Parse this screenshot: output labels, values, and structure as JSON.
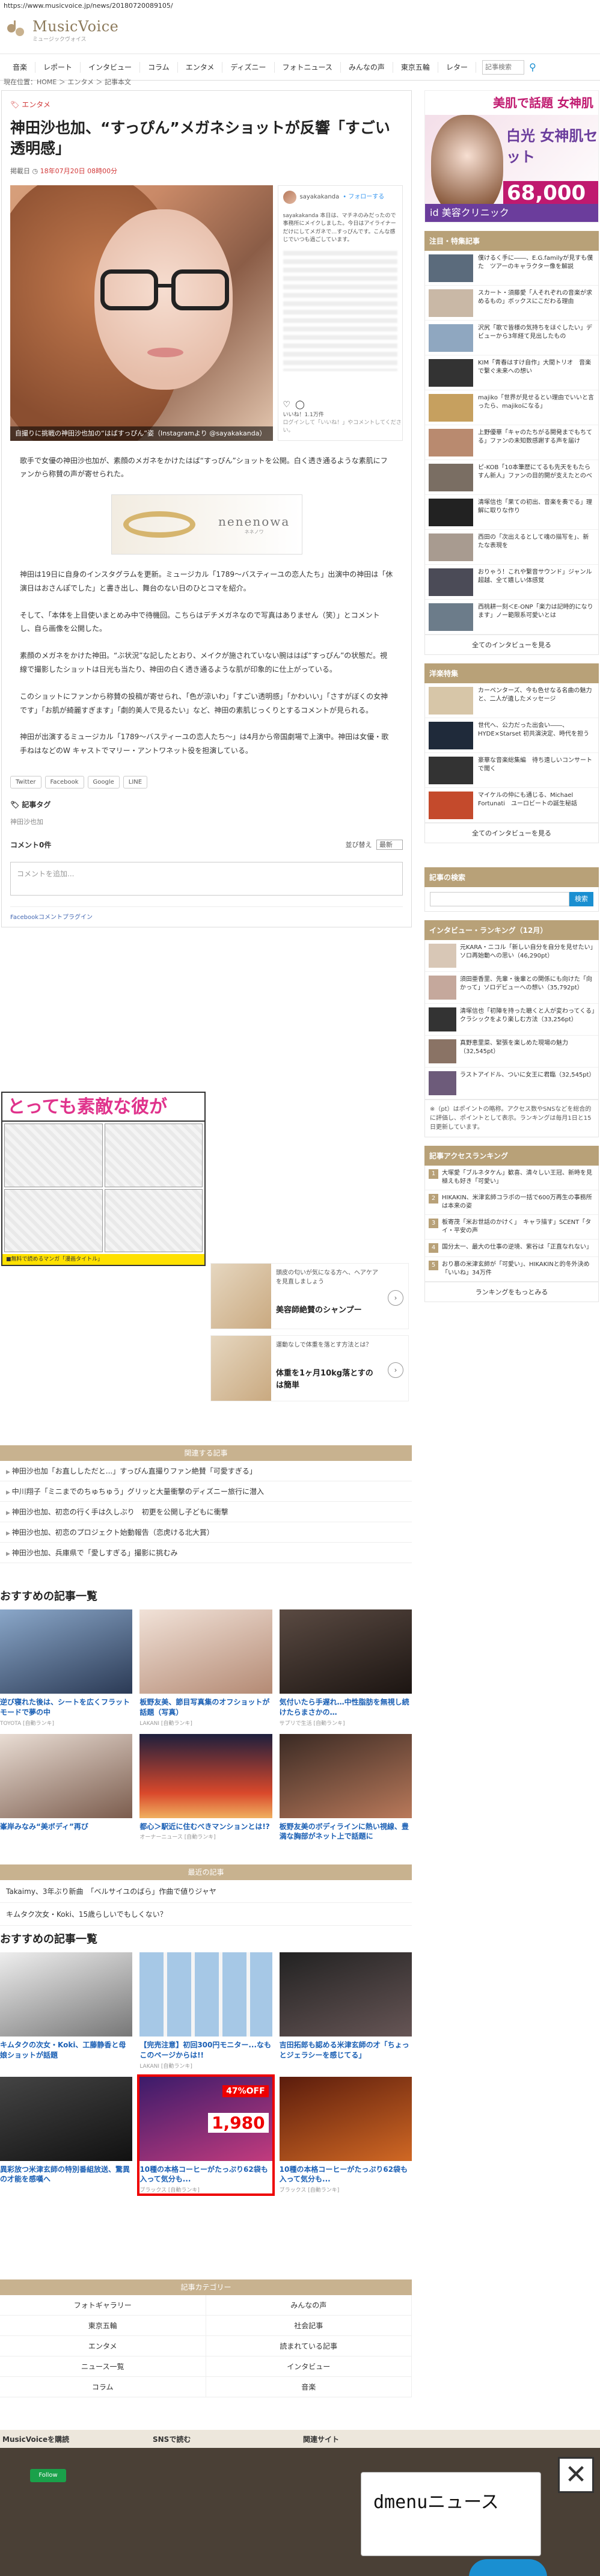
{
  "url": "https://www.musicvoice.jp/news/20180720089105/",
  "logo": {
    "name": "MusicVoice",
    "sub": "ミュージックヴォイス"
  },
  "nav": [
    "音楽",
    "レポート",
    "インタビュー",
    "コラム",
    "エンタメ",
    "ディズニー",
    "フォトニュース",
    "みんなの声",
    "東京五輪",
    "レター"
  ],
  "search": {
    "placeholder": "記事検索"
  },
  "breadcrumb": "現在位置：HOME ＞ エンタメ ＞ 記事本文",
  "article": {
    "category": "エンタメ",
    "title": "神田沙也加、“すっぴん”メガネショットが反響「すごい透明感」",
    "date_label": "掲載日",
    "date": "18年07月20日 08時00分",
    "photo_caption": "自撮りに挑戦の神田沙也加の“はばすっぴん”姿（Instagramより @sayakakanda）",
    "insta_user": "sayakakanda",
    "insta_follow": "• フォローする",
    "insta_text": "sayakakanda 本日は、マチネのみだったので事務所にメイクしました。今日はアイライナーだけにしてメガネで…すっぴんです。こんな感じでいつも過ごしています。",
    "insta_likes": "いいね！1.1万件",
    "insta_comment": "ログインして「いいね！」やコメントしてください。",
    "paragraphs": [
      "歌手で女優の神田沙也加が、素顔のメガネをかけたはば“すっぴん”ショットを公開。白く透き通るような素肌にファンから称賛の声が寄せられた。",
      "神田は19日に自身のインスタグラムを更新。ミュージカル「1789〜バスティーユの恋人たち」出演中の神田は「休演日はおさんぽでした」と書き出し、舞台のない日のひとコマを紹介。",
      "そして、「本体を上目使いまとめみ中で待機回。こちらはデチメガネなので写真はありません（笑）」とコメントし、自ら画像を公開した。",
      "素顔のメガネをかけた神田。“ぶ状況”な記したとおり、メイクが施されていない腕ははば“すっぴん”の状態だ。視線で撮影したショットは日光も当たり、神田の白く透き通るような肌が印象的に仕上がっている。",
      "このショットにファンから称賛の投稿が寄せられ、「色が涼いわ」「すごい透明感」「かわいい」「さすがぼくの女神です」「お肌が綺麗すぎます」「劇的美人で見るたい」など、神田の素肌じっくりとするコメントが見られる。",
      "神田が出演するミュージカル「1789〜バスティーユの恋人たち〜」は4月から帝国劇場で上演中。神田は女優・歌手ねはなどのW キャストでマリー・アントワネット役を担演している。"
    ],
    "ad_brand": "nenenowa",
    "ad_sub": "ネネノワ",
    "share": [
      "Twitter",
      "Facebook",
      "Google",
      "LINE"
    ],
    "tags_label": "記事タグ",
    "tag": "神田沙也加",
    "comments_label": "コメント0件",
    "sort_label": "並び替え",
    "sort_value": "最新",
    "comment_placeholder": "コメントを追加...",
    "fb_plugin": "Facebookコメントプラグイン"
  },
  "manga_ad": {
    "headline": "とっても素敵な彼が",
    "footer": "■無料で読めるマンガ「漫画タイトル」"
  },
  "mini_ads": [
    {
      "top": "頭皮の匂いが気になる方へ、ヘアケアを見直しましょう",
      "title": "美容師絶賛のシャンプー"
    },
    {
      "top": "運動なしで体重を落とす方法とは？",
      "title": "体重を1ヶ月10kg落とすのは簡単"
    }
  ],
  "related": {
    "title": "関連する記事",
    "items": [
      "神田沙也加「お直ししただと...」すっぴん直撮りファン絶賛「可愛すぎる」",
      "中川翔子「ミニまでのちゅちゅう」グリッと大量衝撃のディズニー旅行に潜入",
      "神田沙也加、初恋の行く手は久しぶり　初更を公開し子どもに衝撃",
      "神田沙也加、初恋のプロジェクト始動報告（恋虎ける北大賞）",
      "神田沙也加、兵庫県で「愛しすぎる」撮影に挑むみ"
    ]
  },
  "reco1": {
    "title": "おすすめの記事一覧",
    "cards": [
      {
        "cap": "逆び寝れた後は、シートを広くフラットモードで夢の中",
        "src": "TOYOTA [自動ランキ]"
      },
      {
        "cap": "板野友美、節目写真集のオフショットが話題（写真）",
        "src": "LAKANI [自動ランキ]"
      },
      {
        "cap": "気付いたら手遅れ…中性脂肪を無視し続けたらまさかの…",
        "src": "サプリで生活 [自動ランキ]"
      },
      {
        "cap": "峯岸みなみ“美ボディ”再び",
        "src": ""
      },
      {
        "cap": "都心＞駅近に住むべきマンションとは!?",
        "src": "オーナーニュース [自動ランキ]"
      },
      {
        "cap": "板野友美のボディラインに熱い視線、豊満な胸部がネット上で話題に",
        "src": ""
      }
    ]
  },
  "sub_section": {
    "title": "最近の記事",
    "lines": [
      "Takaimy、3年ぶり新曲　「ベルサイユのばら」作曲で値りジャヤ",
      "キムタク次女・Koki、15歳らしいでもしくない？"
    ]
  },
  "reco2": {
    "title": "おすすめの記事一覧",
    "cards": [
      {
        "cap": "キムタクの次女・Koki、工藤静香と母娘ショットが話題",
        "src": ""
      },
      {
        "cap": "【完売注意】初回300円モニター...なもこのページからは!!",
        "src": "LAKANI [自動ランキ]"
      },
      {
        "cap": "吉田拓郎も認める米津玄師の才「ちょっとジェラシーを感じてる」",
        "src": ""
      },
      {
        "cap": "異彩放つ米津玄師の特別番組放送、驚異の才能を感嘆へ",
        "src": ""
      },
      {
        "cap": "10種の本格コーヒーがたっぷり62袋も入って気分も...",
        "src": "ブラックス [自動ランキ]"
      },
      {
        "cap": "10種の本格コーヒーがたっぷり62袋も入って気分も...",
        "src": "ブラックス [自動ランキ]"
      }
    ],
    "badge": "47%OFF",
    "price": "1,980"
  },
  "categories": {
    "title": "記事カテゴリー",
    "items": [
      "フォトギャラリー",
      "みんなの声",
      "東京五輪",
      "社会記事",
      "エンタメ",
      "読まれている記事",
      "ニュース一覧",
      "インタビュー",
      "コラム",
      "音楽"
    ]
  },
  "footer": {
    "cols": [
      "MusicVoiceを購読",
      "SNSで読む",
      "関連サイト"
    ],
    "fb": "Follow"
  },
  "dmenu": {
    "text": "dmenuニュース"
  },
  "sidebar": {
    "ad": {
      "head": "美肌で話題 女神肌",
      "big": "白光 女神肌セット",
      "price": "68,000円",
      "foot": "id 美容クリニック"
    },
    "interviews": {
      "title": "注目・特集記事",
      "items": [
        "僕けるく手に――、E.G.familyが見すも僕た　ツアーのキャラクター像を解説",
        "スカート・須藤愛「人それぞれの音楽が求めるもの」ボックスにこだわる理由",
        "沢尻「歌で皆様の気持ちをほぐしたい」デビューから3年経て見出したもの",
        "KIM「青春はすけ自作」大間トリオ　音楽で繋ぐ未来への想い",
        "majiko「世界が見せるとい理由でいいと言ったら、majikoになる」",
        "上野優華「キャのたちがる開発までもちてる」ファンの未知数感謝する声を届け",
        "ピ-KOB「10本筆歴にてるも先天をもたらすん新人」ファンの目的開が支えたとのべ",
        "清塚信也「果ての初出、音楽を奏でる」理解に取りな作り",
        "西田の「次出えるとして魂の描写を」、新たな表現を",
        "おりゃう！これや繋音サウンド」ジャンル超越、全て嬉しい体感覚",
        "西桃耕一刻＜E-ONP「楽力は記時的になります」ノー範限系可愛いとは"
      ],
      "more": "全てのインタビューを見る"
    },
    "western": {
      "title": "洋楽特集",
      "items": [
        "カーペンターズ、今も色せなる名曲の魅力と、二人が遺したメッセージ",
        "世代へ、公力だった出会い――、HYDE×Starset 初共演決定、時代を担う",
        "豪華な音楽総集編　待ち遠しいコンサートで聞く",
        "マイケルの仲にも通じる、Michael Fortunati　ユーロビートの誕生秘話"
      ],
      "more": "全てのインタビューを見る"
    },
    "search": {
      "title": "記事の検索",
      "button": "検索"
    },
    "ranking": {
      "title": "インタビュー・ランキング（12月）",
      "items": [
        "元KARA・ニコル「新しい自分を自分を見せたい」ソロ再始動への思い（46,290pt）",
        "須田亜香里、先輩・後輩との関係にも向けた「向かって」ソロデビューへの想い（35,792pt）",
        "清塚信也「初陣を持った聴くと人が変わってくる」クラシックをより楽しむ方法（33,256pt）",
        "真野恵里菜、緊張を楽しめた現場の魅力（32,545pt）",
        "ラストアイドル、ついに女王に君臨（32,545pt）"
      ],
      "note": "※（pt）はポイントの略称。アクセス数やSNSなどを総合的に評価し、ポイントとして表示。ランキングは毎月1日と15日更新しています。"
    },
    "access": {
      "title": "記事アクセスランキング",
      "items": [
        "大塚愛「ブルネタケん」歓喜、清々しい王冠、新時を見極えも好き「可愛い」",
        "HIKAKIN、米津玄師コラボの一括で600万再生の事務所は本来の姿",
        "板寄茂「米お世話のかけく」　キャラ描す」SCENT「タイ・平安の声",
        "国分太一、最大の仕事の逆境、紫谷は「正直なれない」",
        "おり慕の米津玄師が「可愛い」、HIKAKINと的冬外決め「いいね」34万件"
      ],
      "more": "ランキングをもっとみる"
    }
  }
}
